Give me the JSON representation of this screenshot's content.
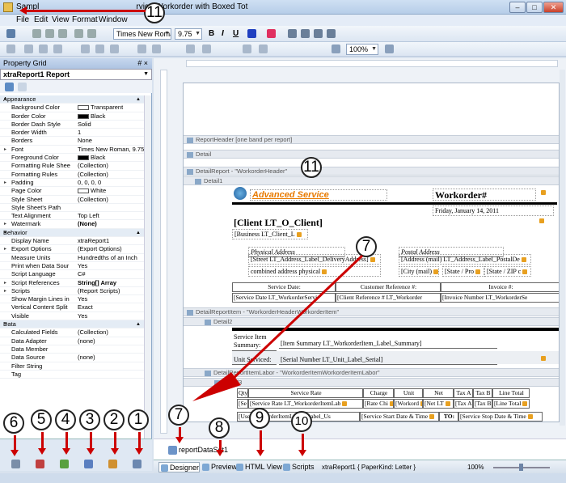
{
  "window": {
    "title": "Sample Custom Service Workorder with Boxed Totals",
    "title_visible": "Sampl",
    "title_tail": "rvice Workorder with Boxed Tot"
  },
  "menu": [
    "File",
    "Edit",
    "View",
    "Format",
    "Window"
  ],
  "toolbar": {
    "font": "Times New Roman",
    "size": "9.75",
    "bold": "B",
    "italic": "I",
    "underline": "U",
    "zoom": "100%"
  },
  "property_grid": {
    "title": "Property Grid",
    "pin": "# ×",
    "object": "xtraReport1  Report",
    "rows": [
      {
        "cat": true,
        "name": "Appearance"
      },
      {
        "name": "Background Color",
        "value": "Transparent",
        "swatch": "#ffffff"
      },
      {
        "name": "Border Color",
        "value": "Black",
        "swatch": "#000000"
      },
      {
        "name": "Border Dash Style",
        "value": "Solid"
      },
      {
        "name": "Border Width",
        "value": "1"
      },
      {
        "name": "Borders",
        "value": "None"
      },
      {
        "name": "Font",
        "value": "Times New Roman, 9.75pt",
        "exp": true
      },
      {
        "name": "Foreground Color",
        "value": "Black",
        "swatch": "#000000"
      },
      {
        "name": "Formatting Rule Shee",
        "value": "(Collection)"
      },
      {
        "name": "Formatting Rules",
        "value": "(Collection)"
      },
      {
        "name": "Padding",
        "value": "0, 0, 0, 0",
        "exp": true
      },
      {
        "name": "Page Color",
        "value": "White",
        "swatch": "#ffffff"
      },
      {
        "name": "Style Sheet",
        "value": "(Collection)"
      },
      {
        "name": "Style Sheet's Path",
        "value": ""
      },
      {
        "name": "Text Alignment",
        "value": "Top Left"
      },
      {
        "name": "Watermark",
        "value": "(None)",
        "exp": true,
        "bold": true
      },
      {
        "cat": true,
        "name": "Behavior"
      },
      {
        "name": "Display Name",
        "value": "xtraReport1"
      },
      {
        "name": "Export Options",
        "value": "(Export Options)",
        "exp": true
      },
      {
        "name": "Measure Units",
        "value": "Hundredths of an Inch"
      },
      {
        "name": "Print when Data Sour",
        "value": "Yes"
      },
      {
        "name": "Script Language",
        "value": "C#"
      },
      {
        "name": "Script References",
        "value": "String[] Array",
        "exp": true,
        "bold": true
      },
      {
        "name": "Scripts",
        "value": "(Report Scripts)",
        "exp": true
      },
      {
        "name": "Show Margin Lines in",
        "value": "Yes"
      },
      {
        "name": "Vertical Content Split",
        "value": "Exact"
      },
      {
        "name": "Visible",
        "value": "Yes"
      },
      {
        "cat": true,
        "name": "Data"
      },
      {
        "name": "Calculated Fields",
        "value": "(Collection)"
      },
      {
        "name": "Data Adapter",
        "value": "(none)"
      },
      {
        "name": "Data Member",
        "value": ""
      },
      {
        "name": "Data Source",
        "value": "(none)"
      },
      {
        "name": "Filter String",
        "value": ""
      },
      {
        "name": "Tag",
        "value": ""
      }
    ]
  },
  "bands": {
    "report_header": "ReportHeader [one band per report]",
    "detail": "Detail",
    "detail_report": "DetailReport - \"WorkorderHeader\"",
    "detail1": "Detail1",
    "detail_report_item": "DetailReportItem - \"WorkorderHeaderWorkorderItem\"",
    "detail2": "Detail2",
    "detail_report_labor": "DetailReportItemLabor - \"WorkorderItemWorkorderItemLabor\"",
    "detail3": "Detail3"
  },
  "report": {
    "brand": "Advanced Service",
    "doc_title": "Workorder#",
    "date": "Friday, January 14, 2011",
    "client": "[Client    LT_O_Client]",
    "business": "[Business   LT_Client_L",
    "physical_address": "Physical Address",
    "street": "[Street    LT_Address_Label_DeliveryAddress]",
    "combined": "combined address physical",
    "postal_address": "Postal Address",
    "address_mail": "[Address (mail)   LT_Address_Label_PostalDe",
    "city": "[City (mail)",
    "state": "[State / Pro",
    "zip": "[State / ZIP c",
    "service_date_h": "Service Date:",
    "cust_ref_h": "Customer Reference #:",
    "invoice_h": "Invoice #:",
    "service_date_v": "[Service Date  LT_WorkorderServi",
    "cust_ref_v": "[Client Reference #  LT_Workorder",
    "invoice_v": "[Invoice Number   LT_WorkorderSe",
    "service_item_h": "Service Item Summary:",
    "service_item_v": "[Item Summary   LT_WorkorderItem_Label_Summary]",
    "unit_serviced_h": "Unit Serviced:",
    "unit_serviced_v": "[Serial Number   LT_Unit_Label_Serial]",
    "cols": [
      "Qty",
      "Service Rate",
      "Charge",
      "Unit",
      "Net",
      "Tax A",
      "Tax B",
      "Line Total"
    ],
    "row1": [
      "[Se",
      "[Service Rate   LT_WorkorderItemLab",
      "[Rate Chi",
      "[Workord",
      "[Net   LT",
      "[Tax A",
      "[Tax B",
      "[Line Total"
    ],
    "row2_a": "[User",
    "row2_b": "workorderItemLabor_Label_Us",
    "row2_c": "[Service Start Date & Time",
    "row2_to": "TO:",
    "row2_d": "[Service Stop Date & Time"
  },
  "component_tray": {
    "item": "reportDataSet1"
  },
  "tabs": [
    "Designer",
    "Preview",
    "HTML View",
    "Scripts"
  ],
  "status": {
    "report": "xtraReport1 { PaperKind: Letter }",
    "zoom": "100%"
  },
  "badges": {
    "b1": "1",
    "b2": "2",
    "b3": "3",
    "b4": "4",
    "b5": "5",
    "b6": "6",
    "b7a": "7",
    "b7b": "7",
    "b8": "8",
    "b9": "9",
    "b10": "10",
    "b11a": "11",
    "b11b": "11"
  },
  "colors": {
    "accent_arrow": "#cc0000",
    "brand_text": "#e87a00"
  }
}
